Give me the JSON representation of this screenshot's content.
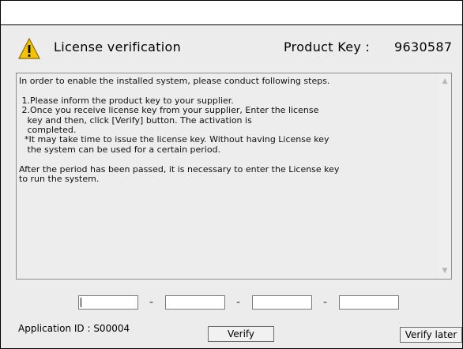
{
  "dialog": {
    "title": "License verification",
    "product_key_label": "Product Key :",
    "product_key_value": "9630587"
  },
  "instructions": {
    "text": "In order to enable the installed system, please conduct following steps.\n\n 1.Please inform the product key to your supplier.\n 2.Once you receive license key from your supplier, Enter the license\n   key and then, click [Verify] button. The activation is\n   completed.\n  *It may take time to issue the license key. Without having License key\n   the system can be used for a certain period.\n\nAfter the period has been passed, it is necessary to enter the License key\nto run the system."
  },
  "license_key_inputs": [
    {
      "value": ""
    },
    {
      "value": ""
    },
    {
      "value": ""
    },
    {
      "value": ""
    }
  ],
  "separators": [
    "-",
    "-",
    "-"
  ],
  "footer": {
    "application_id": "Application ID : S00004",
    "verify_label": "Verify",
    "verify_later_label": "Verify later"
  },
  "icons": {
    "warning": "warning-icon",
    "scroll_up": "scroll-up-icon",
    "scroll_down": "scroll-down-icon"
  },
  "colors": {
    "window_bg": "#ececec",
    "warning_yellow": "#f5c400"
  }
}
